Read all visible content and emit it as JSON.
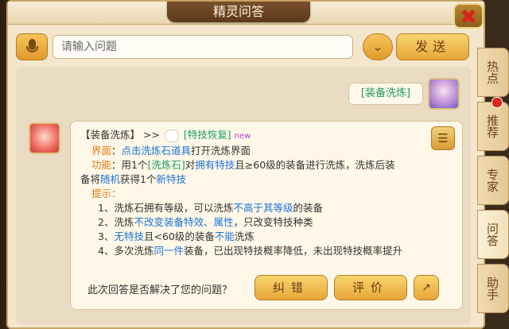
{
  "window": {
    "title": "精灵问答"
  },
  "close_glyph": "✖",
  "search": {
    "placeholder": "请输入问题",
    "value": "",
    "send_label": "发送"
  },
  "user_message": "[装备洗炼]",
  "bot_message": {
    "head_tag": "【装备洗炼】",
    "head_arrow": ">>",
    "head_link": "[特技恢复]",
    "head_new": "new",
    "interface_label": "界面",
    "interface_sep": "：",
    "interface_link": "点击洗炼石道具",
    "interface_rest": "打开洗炼界面",
    "function_label": "功能",
    "function_sep": "：用1个",
    "function_item": "[洗炼石]",
    "function_p1": "对",
    "function_highlight": "拥有特技",
    "function_p2": "且≥60级的装备进行洗炼，洗炼后装",
    "function_line2_p1": "备将",
    "function_random": "随机",
    "function_line2_p2": "获得1个",
    "function_new_skill": "新特技",
    "tips_label": "提示",
    "tips_colon": "：",
    "tip1_a": "1、洗炼石拥有等级，可以洗炼",
    "tip1_b": "不高于其等级",
    "tip1_c": "的装备",
    "tip2_a": "2、洗炼",
    "tip2_b": "不改变装备特效、属性",
    "tip2_c": "，只改变特技种类",
    "tip3_a": "3、",
    "tip3_b": "无特技",
    "tip3_c": "且<60级的装备",
    "tip3_d": "不能",
    "tip3_e": "洗炼",
    "tip4_a": "4、多次洗炼",
    "tip4_b": "同一件",
    "tip4_c": "装备，已出现特技概率降低，未出现特技概率提升"
  },
  "feedback": {
    "question": "此次回答是否解决了您的问题？",
    "correct_label": "纠错",
    "rate_label": "评价"
  },
  "side_tabs": {
    "hot": "热点",
    "recommend": "推荐",
    "expert": "专家",
    "qa": "问答",
    "helper": "助手"
  },
  "colors": {
    "accent_orange": "#e07a12",
    "link_blue": "#1a73d9",
    "item_green": "#1d9a5f",
    "badge_red": "#d8261b"
  }
}
